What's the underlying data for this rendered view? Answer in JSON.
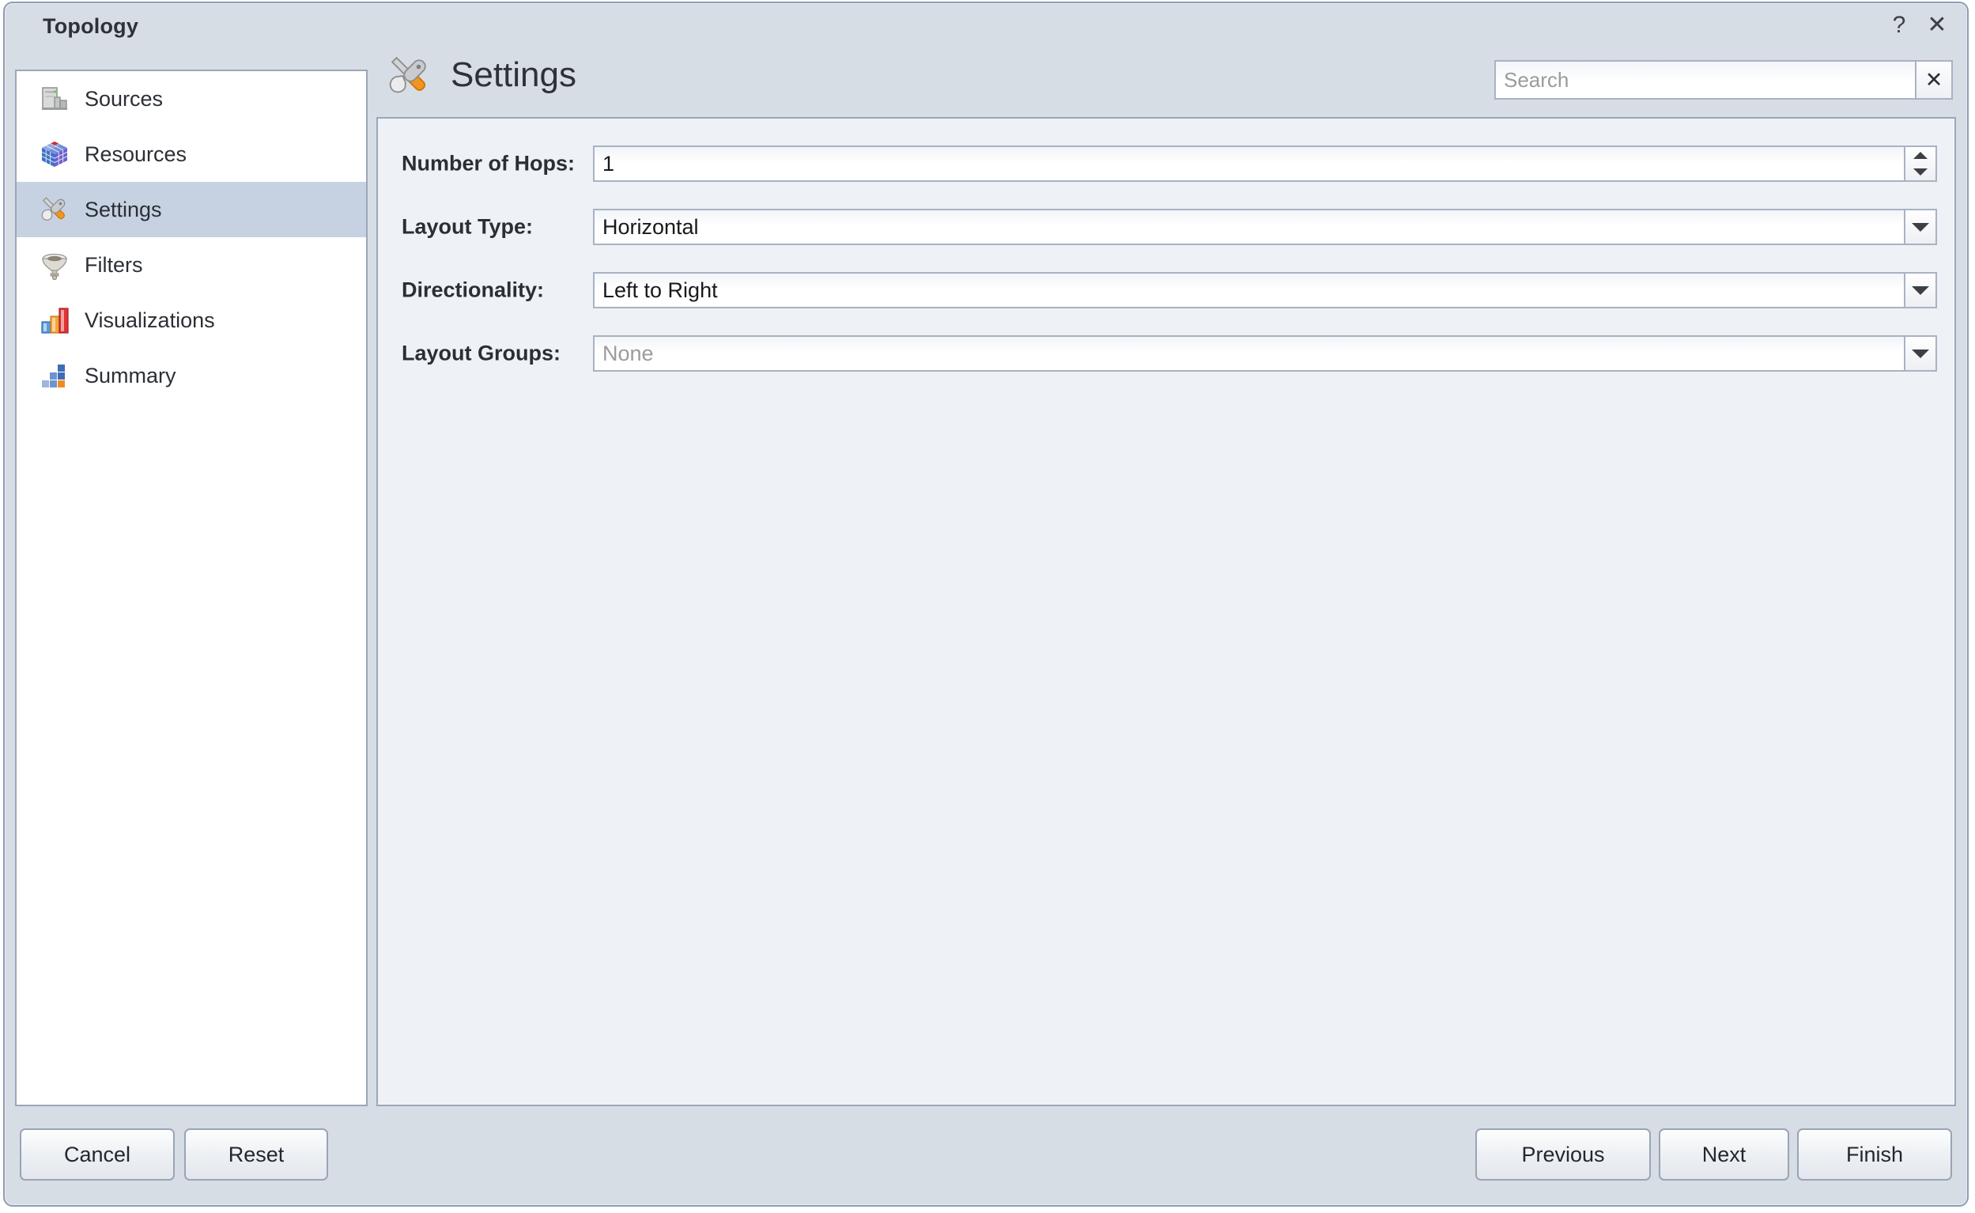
{
  "window": {
    "title": "Topology",
    "help_label": "?",
    "close_label": "✕"
  },
  "sidebar": {
    "items": [
      {
        "label": "Sources",
        "icon": "server-icon",
        "selected": false
      },
      {
        "label": "Resources",
        "icon": "cube-icon",
        "selected": false
      },
      {
        "label": "Settings",
        "icon": "tools-icon",
        "selected": true
      },
      {
        "label": "Filters",
        "icon": "filter-funnel-icon",
        "selected": false
      },
      {
        "label": "Visualizations",
        "icon": "bar-chart-icon",
        "selected": false
      },
      {
        "label": "Summary",
        "icon": "summary-grid-icon",
        "selected": false
      }
    ]
  },
  "header": {
    "title": "Settings",
    "icon": "tools-icon"
  },
  "search": {
    "value": "",
    "placeholder": "Search",
    "clear_label": "✕"
  },
  "form": {
    "rows": [
      {
        "label": "Number of Hops:",
        "value": "1",
        "control": "spinner",
        "disabled": false
      },
      {
        "label": "Layout Type:",
        "value": "Horizontal",
        "control": "dropdown",
        "disabled": false
      },
      {
        "label": "Directionality:",
        "value": "Left to Right",
        "control": "dropdown",
        "disabled": false
      },
      {
        "label": "Layout Groups:",
        "value": "None",
        "control": "dropdown",
        "disabled": true
      }
    ]
  },
  "footer": {
    "cancel_label": "Cancel",
    "reset_label": "Reset",
    "previous_label": "Previous",
    "next_label": "Next",
    "finish_label": "Finish"
  },
  "colors": {
    "titlebar_bg": "#d7dde5",
    "content_bg": "#eef2f6",
    "panel_bg": "#ffffff",
    "selection_bg": "#c6d2e2",
    "border": "#9aa7b8",
    "accent_orange": "#f08a1e"
  }
}
